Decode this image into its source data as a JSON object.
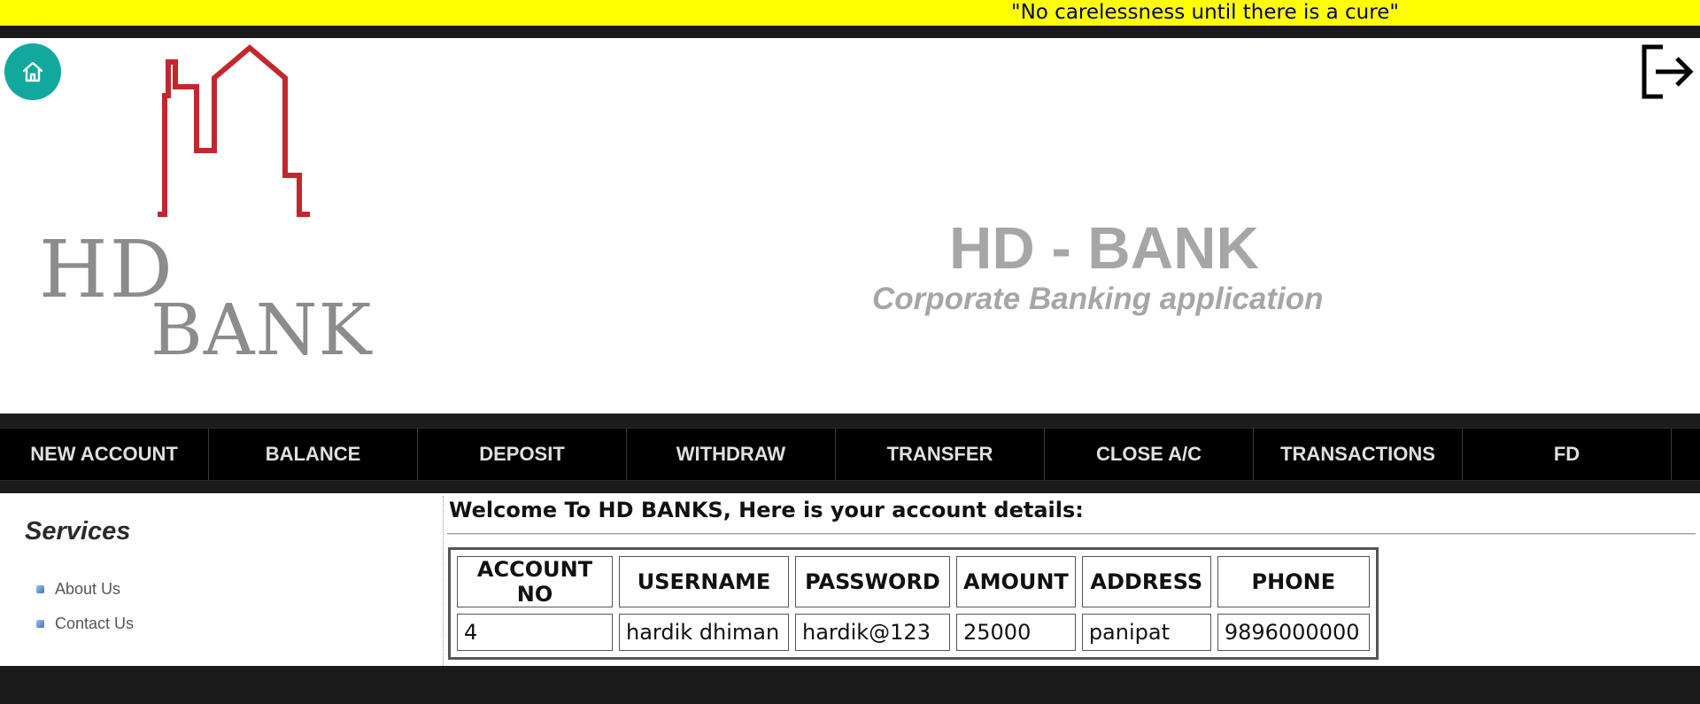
{
  "marquee": {
    "text": "\"No carelessness until there is a cure\""
  },
  "header": {
    "logo": {
      "line1": "HD",
      "line2": "BANK"
    },
    "title": "HD - BANK",
    "subtitle": "Corporate Banking application",
    "home_icon": "home-icon",
    "logout_icon": "logout-icon"
  },
  "nav": {
    "items": [
      "NEW ACCOUNT",
      "BALANCE",
      "DEPOSIT",
      "WITHDRAW",
      "TRANSFER",
      "CLOSE A/C",
      "TRANSACTIONS",
      "FD"
    ]
  },
  "sidebar": {
    "title": "Services",
    "links": [
      "About Us",
      "Contact Us"
    ]
  },
  "main": {
    "welcome": "Welcome To HD BANKS, Here is your account details:",
    "table": {
      "headers": [
        "ACCOUNT NO",
        "USERNAME",
        "PASSWORD",
        "AMOUNT",
        "ADDRESS",
        "PHONE"
      ],
      "rows": [
        [
          "4",
          "hardik dhiman",
          "hardik@123",
          "25000",
          "panipat",
          "9896000000"
        ]
      ]
    }
  },
  "colors": {
    "marquee_bg": "#ffff00",
    "home_button": "#13a89e",
    "logo_red": "#c1272d",
    "nav_bg": "#000000"
  }
}
